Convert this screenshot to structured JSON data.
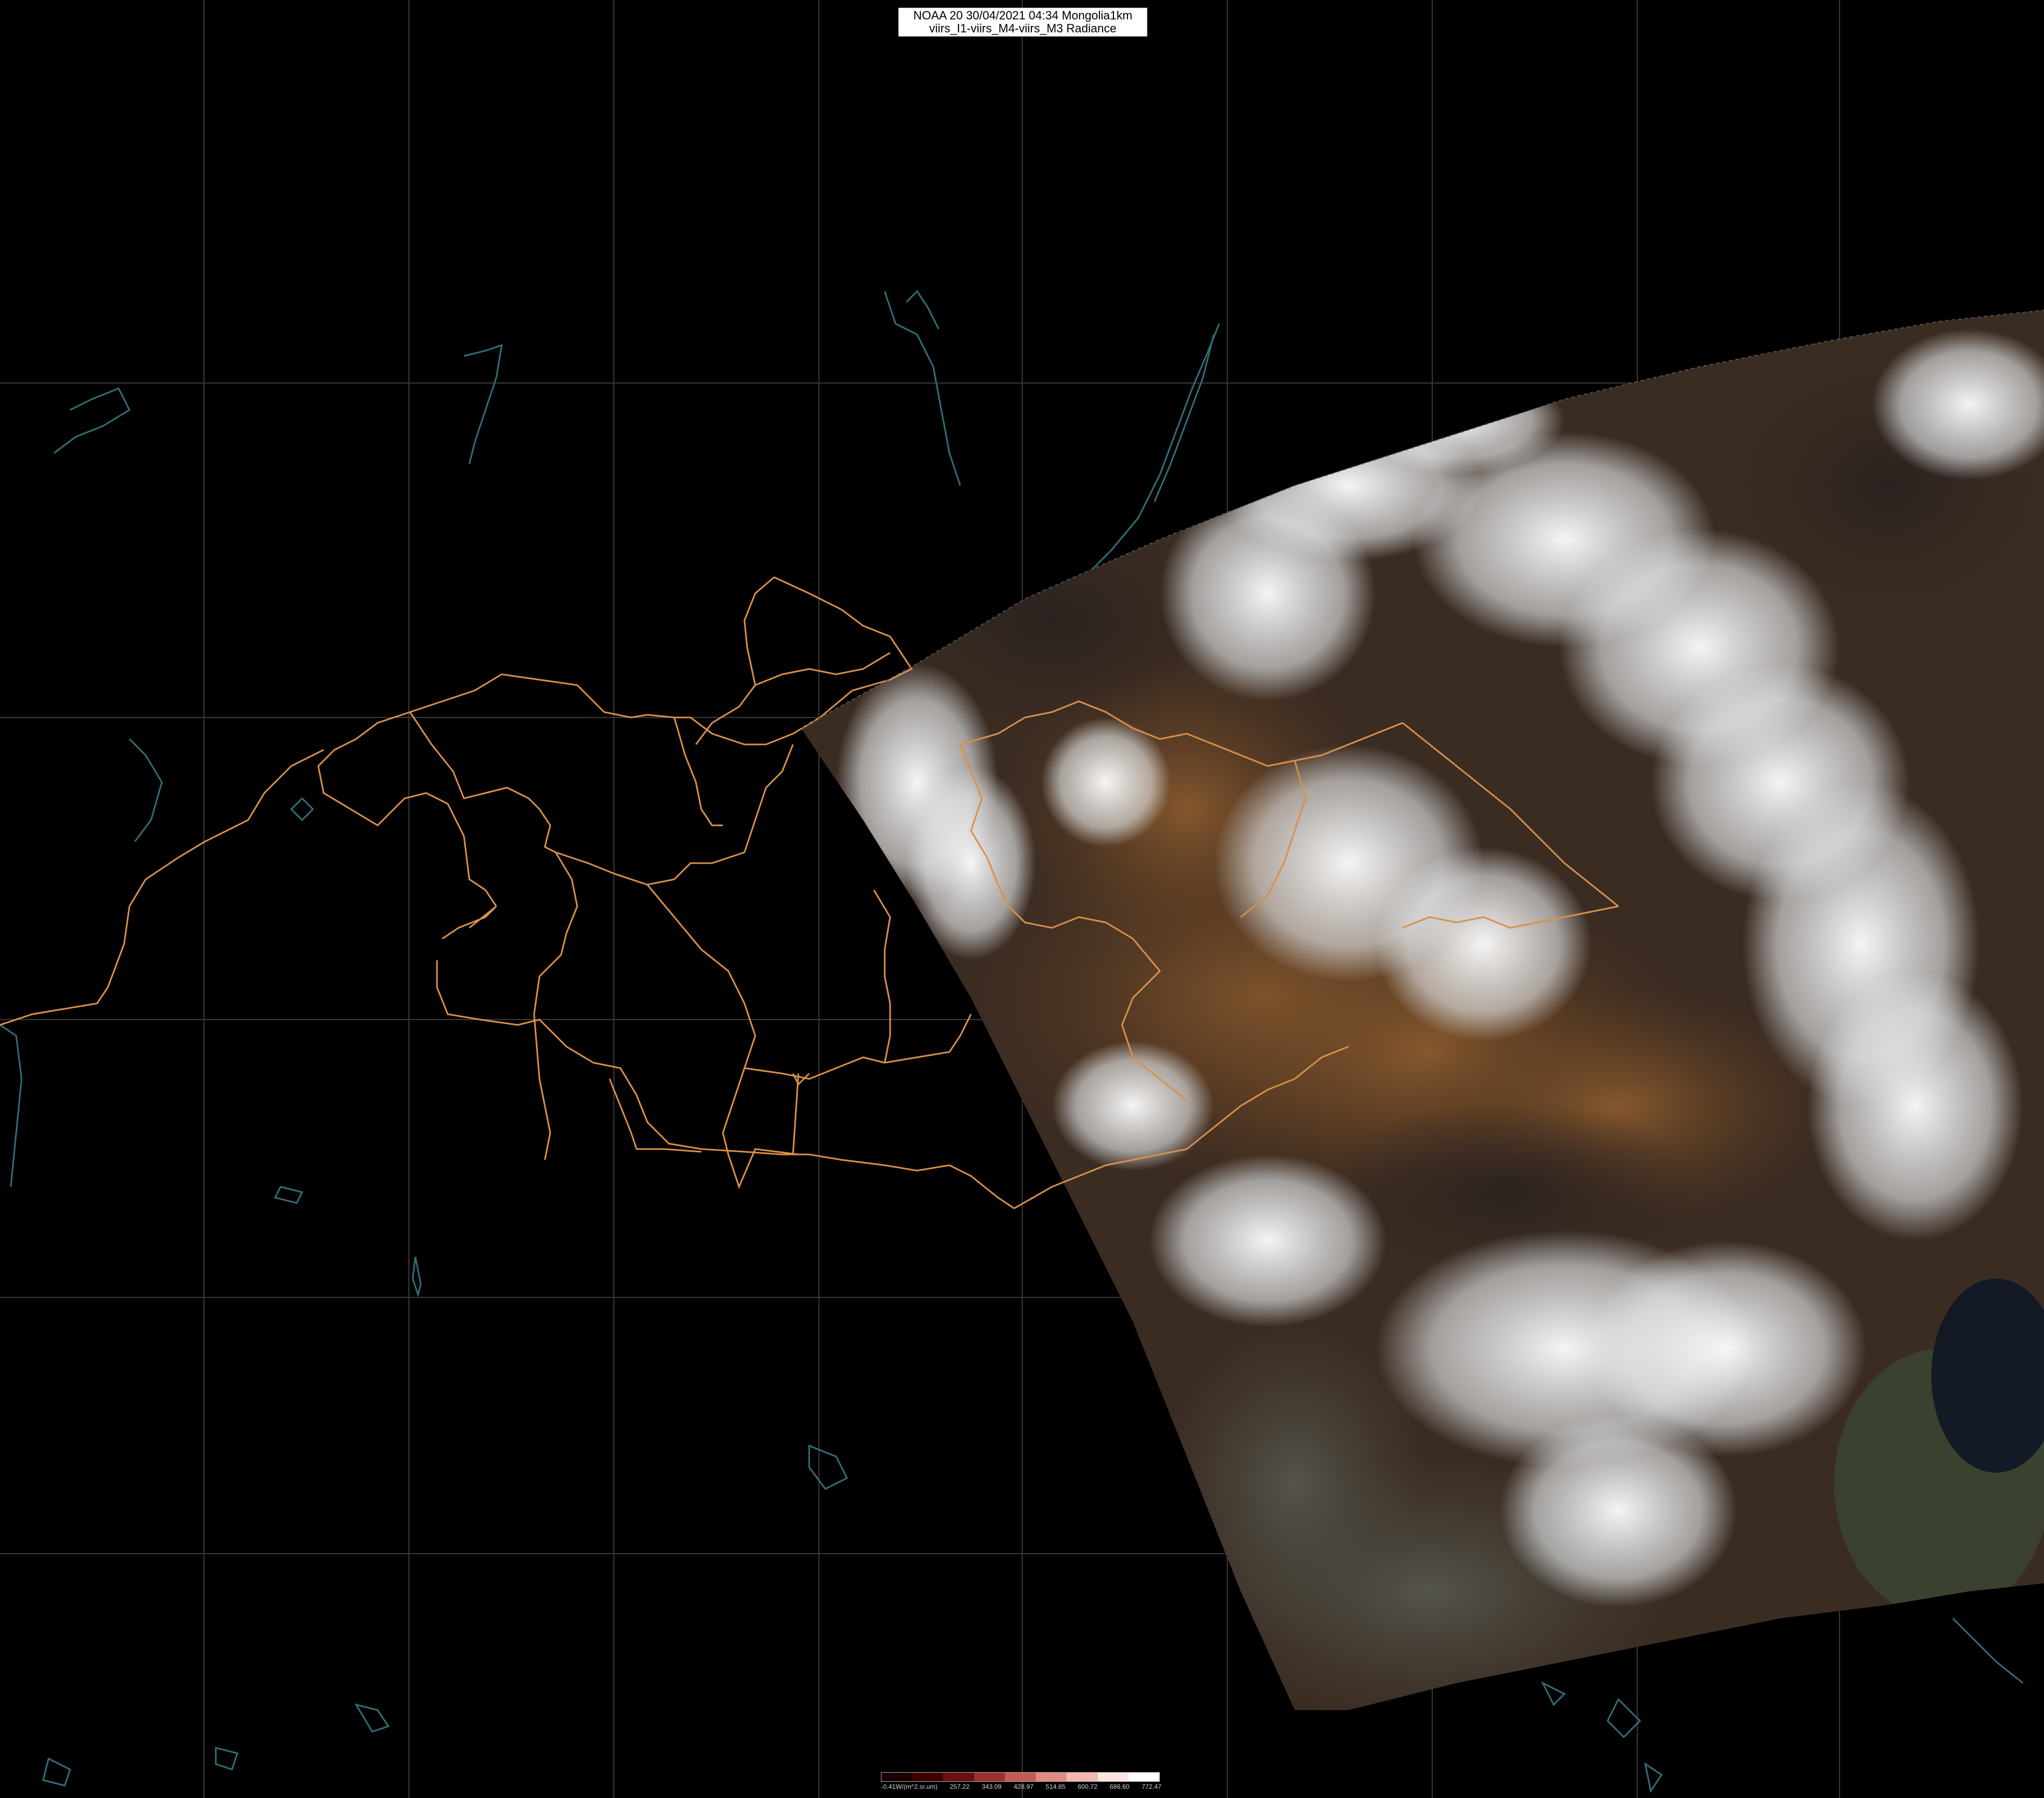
{
  "header": {
    "line1": "NOAA 20 30/04/2021 04:34 Mongolia1km",
    "line2": "viirs_I1-viirs_M4-viirs_M3 Radiance"
  },
  "colorbar": {
    "ticks": [
      "-0.41W/(m^2.sr.um)",
      "257.22",
      "343.09",
      "428.97",
      "514.85",
      "600.72",
      "686.60",
      "772.47"
    ],
    "colors": [
      "#1a0000",
      "#3d0000",
      "#6a1010",
      "#9a3030",
      "#c45a50",
      "#e08a80",
      "#f2b8b0",
      "#fde4e0",
      "#ffffff"
    ]
  },
  "style": {
    "background": "#000000",
    "gridline_color": "#3a3a3a",
    "border_color": "#d9904a",
    "coastline_color": "#2f6f78"
  }
}
